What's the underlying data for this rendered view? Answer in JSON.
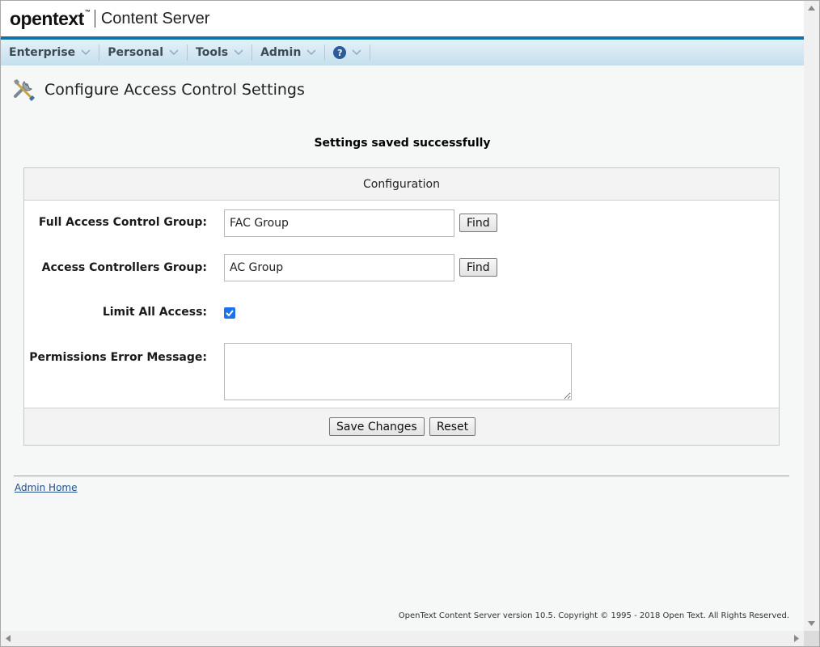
{
  "header": {
    "logo_main": "opentext",
    "logo_tm": "™",
    "logo_product": "Content Server"
  },
  "nav": {
    "items": [
      {
        "label": "Enterprise"
      },
      {
        "label": "Personal"
      },
      {
        "label": "Tools"
      },
      {
        "label": "Admin"
      }
    ],
    "help_symbol": "?"
  },
  "page": {
    "title": "Configure Access Control Settings",
    "status_message": "Settings saved successfully"
  },
  "config": {
    "heading": "Configuration",
    "full_access_label": "Full Access Control Group:",
    "full_access_value": "FAC Group",
    "access_controllers_label": "Access Controllers Group:",
    "access_controllers_value": "AC Group",
    "find_label": "Find",
    "limit_all_label": "Limit All Access:",
    "limit_all_checked": true,
    "permissions_error_label": "Permissions Error Message:",
    "permissions_error_value": "",
    "save_label": "Save Changes",
    "reset_label": "Reset"
  },
  "footer": {
    "admin_home": "Admin Home",
    "copyright": "OpenText Content Server version 10.5. Copyright © 1995 - 2018 Open Text. All Rights Reserved."
  },
  "colors": {
    "nav_accent": "#1272a6",
    "checkbox": "#1a73e8",
    "link": "#1f4f8f"
  }
}
